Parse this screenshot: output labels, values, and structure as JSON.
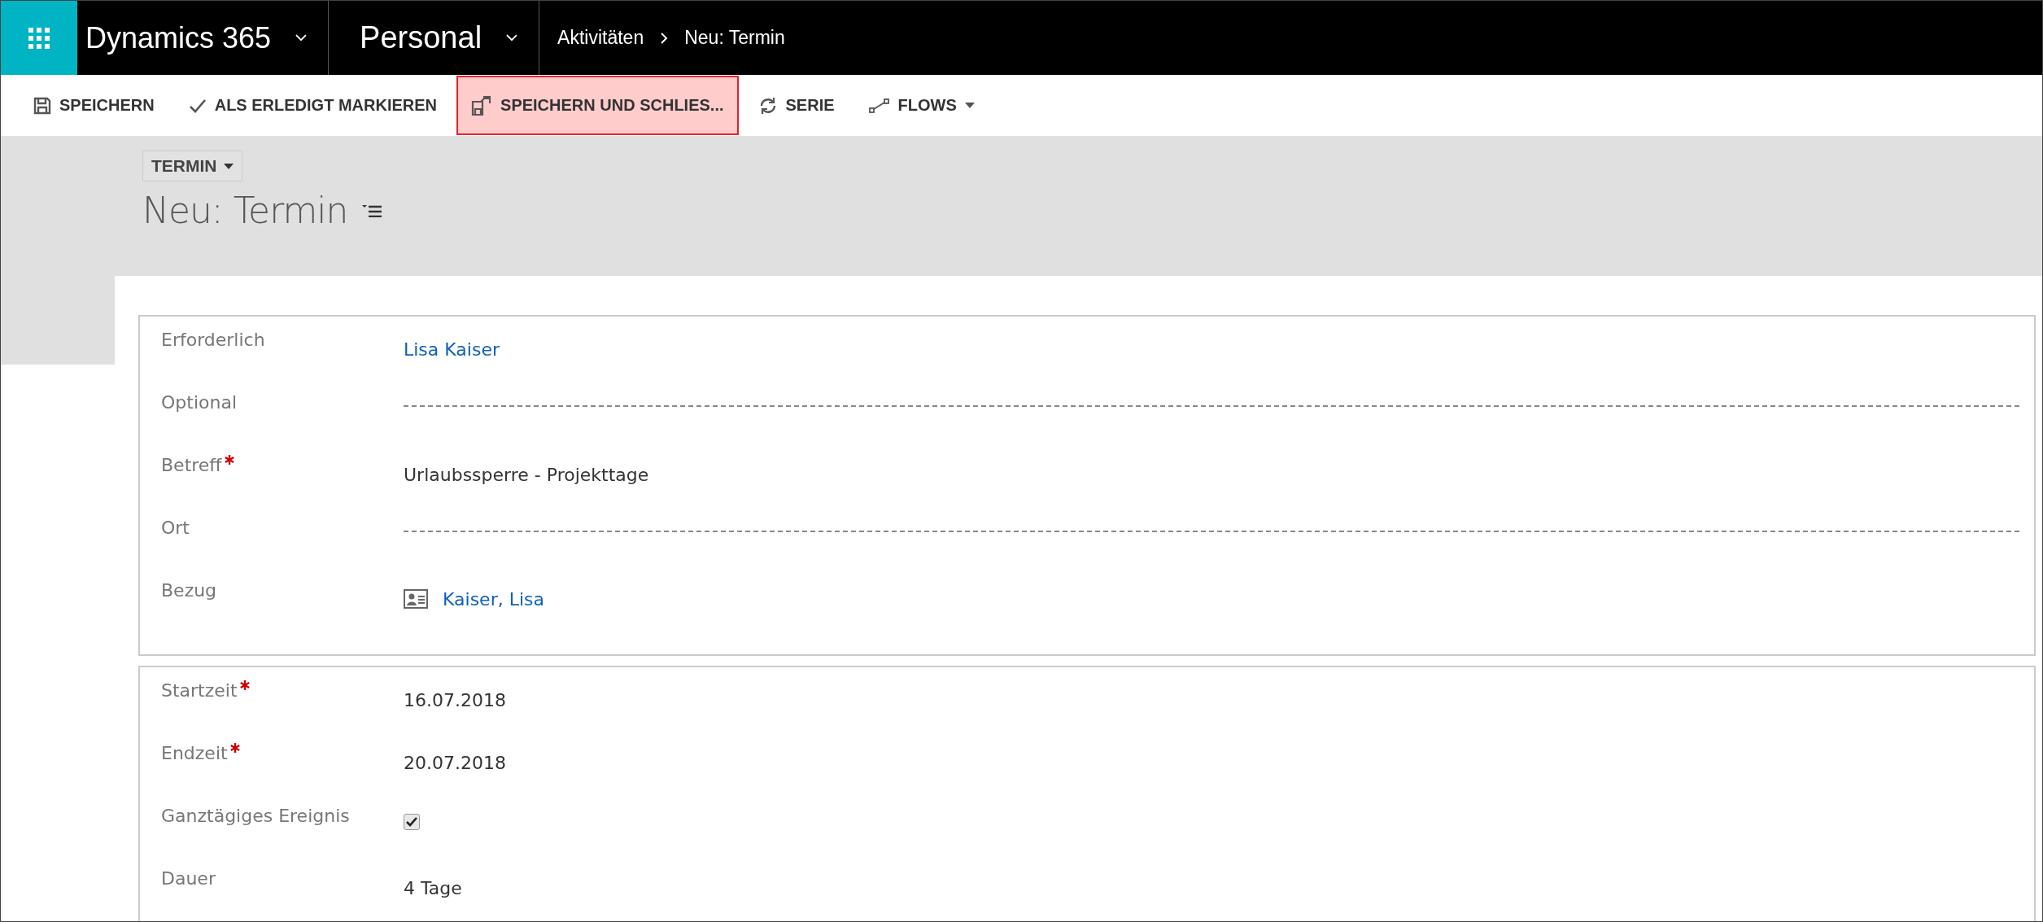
{
  "nav_bar": {
    "app_name": "Dynamics 365",
    "area": "Personal",
    "breadcrumb": [
      "Aktivitäten",
      "Neu: Termin"
    ]
  },
  "toolbar": [
    {
      "label": "SPEICHERN",
      "kind": "save",
      "highlighted": false,
      "dropdown": false
    },
    {
      "label": "ALS ERLEDIGT MARKIEREN",
      "kind": "check",
      "highlighted": false,
      "dropdown": false
    },
    {
      "label": "SPEICHERN UND SCHLIES...",
      "kind": "save_close",
      "highlighted": true,
      "dropdown": false
    },
    {
      "label": "SERIE",
      "kind": "refresh",
      "highlighted": false,
      "dropdown": false
    },
    {
      "label": "FLOWS",
      "kind": "flow",
      "highlighted": false,
      "dropdown": true
    }
  ],
  "header": {
    "form_selector": "TERMIN",
    "title": "Neu: Termin"
  },
  "sections": [
    {
      "fields": [
        {
          "label": "Erforderlich",
          "required": false,
          "kind": "link",
          "value": "Lisa Kaiser"
        },
        {
          "label": "Optional",
          "required": false,
          "kind": "empty"
        },
        {
          "label": "Betreff",
          "required": true,
          "kind": "text",
          "value": "Urlaubssperre - Projekttage"
        },
        {
          "label": "Ort",
          "required": false,
          "kind": "empty"
        },
        {
          "label": "Bezug",
          "required": false,
          "kind": "contact_link",
          "value": "Kaiser, Lisa"
        }
      ]
    },
    {
      "fields": [
        {
          "label": "Startzeit",
          "required": true,
          "kind": "text",
          "value": "16.07.2018"
        },
        {
          "label": "Endzeit",
          "required": true,
          "kind": "text",
          "value": "20.07.2018"
        },
        {
          "label": "Ganztägiges Ereignis",
          "required": false,
          "kind": "checkbox",
          "checked": true
        },
        {
          "label": "Dauer",
          "required": false,
          "kind": "text",
          "value": "4 Tage"
        }
      ]
    }
  ]
}
